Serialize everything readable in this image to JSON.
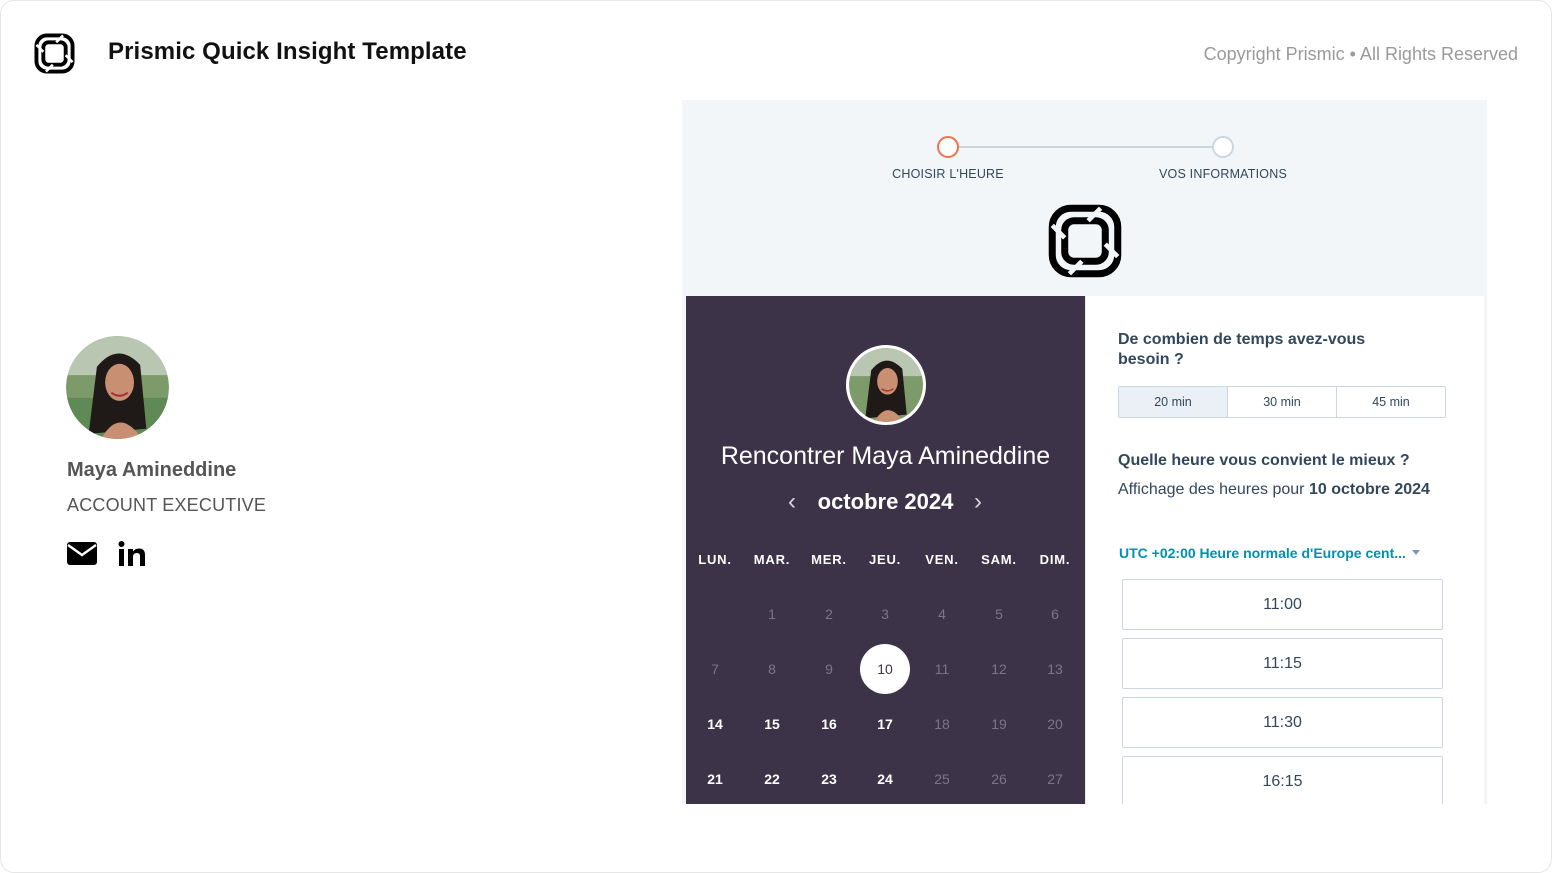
{
  "header": {
    "title": "Prismic Quick Insight Template",
    "copyright": "Copyright Prismic • All Rights Reserved"
  },
  "profile": {
    "name": "Maya Amineddine",
    "role": "ACCOUNT EXECUTIVE"
  },
  "booking": {
    "steps": [
      "CHOISIR L'HEURE",
      "VOS INFORMATIONS"
    ],
    "title": "Rencontrer Maya Amineddine",
    "month": "octobre 2024",
    "prev": "‹",
    "next": "›",
    "weekdays": [
      "LUN.",
      "MAR.",
      "MER.",
      "JEU.",
      "VEN.",
      "SAM.",
      "DIM."
    ],
    "weeks": [
      [
        "",
        "1",
        "2",
        "3",
        "4",
        "5",
        "6"
      ],
      [
        "7",
        "8",
        "9",
        "10",
        "11",
        "12",
        "13"
      ],
      [
        "14",
        "15",
        "16",
        "17",
        "18",
        "19",
        "20"
      ],
      [
        "21",
        "22",
        "23",
        "24",
        "25",
        "26",
        "27"
      ]
    ],
    "selected_day": "10",
    "available_days": [
      "14",
      "15",
      "16",
      "17",
      "21",
      "22",
      "23",
      "24"
    ],
    "duration_question": "De combien de temps avez-vous besoin ?",
    "durations": [
      "20 min",
      "30 min",
      "45 min"
    ],
    "selected_duration": "20 min",
    "time_question": "Quelle heure vous convient le mieux ?",
    "showing_prefix": "Affichage des heures pour",
    "showing_date": "10 octobre 2024",
    "timezone": "UTC +02:00 Heure normale d'Europe cent...",
    "slots": [
      "11:00",
      "11:15",
      "11:30",
      "16:15"
    ]
  },
  "colors": {
    "calendar_bg": "#3d3349",
    "active_step": "#f2714f",
    "timezone_link": "#0091ae",
    "text_dark": "#33475b"
  }
}
